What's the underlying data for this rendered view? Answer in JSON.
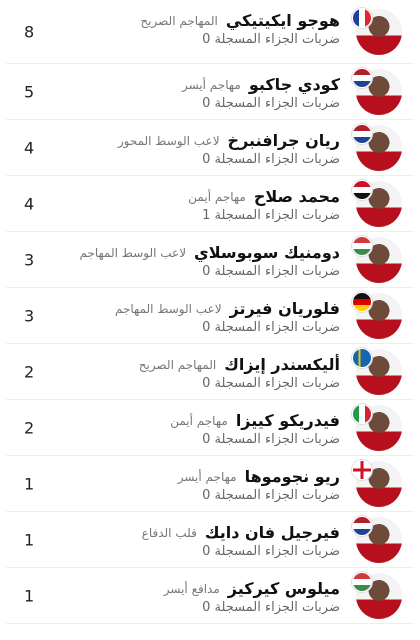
{
  "rows": [
    {
      "name": "هوجو ايكيتيكي",
      "position": "المهاجم الصريح",
      "stat_label": "ضربات الجزاء المسجلة",
      "stat_value": "0",
      "value": "8",
      "flag": "france"
    },
    {
      "name": "كودي جاكبو",
      "position": "مهاجم أيسر",
      "stat_label": "ضربات الجزاء المسجلة",
      "stat_value": "0",
      "value": "5",
      "flag": "netherlands"
    },
    {
      "name": "ريان جرافنبرخ",
      "position": "لاعب الوسط المحور",
      "stat_label": "ضربات الجزاء المسجلة",
      "stat_value": "0",
      "value": "4",
      "flag": "netherlands"
    },
    {
      "name": "محمد صلاح",
      "position": "مهاجم أيمن",
      "stat_label": "ضربات الجزاء المسجلة",
      "stat_value": "1",
      "value": "4",
      "flag": "egypt"
    },
    {
      "name": "دومنيك سوبوسلاي",
      "position": "لاعب الوسط المهاجم",
      "stat_label": "ضربات الجزاء المسجلة",
      "stat_value": "0",
      "value": "3",
      "flag": "hungary"
    },
    {
      "name": "فلوريان فيرتز",
      "position": "لاعب الوسط المهاجم",
      "stat_label": "ضربات الجزاء المسجلة",
      "stat_value": "0",
      "value": "3",
      "flag": "germany"
    },
    {
      "name": "أليكسندر إيزاك",
      "position": "المهاجم الصريح",
      "stat_label": "ضربات الجزاء المسجلة",
      "stat_value": "0",
      "value": "2",
      "flag": "sweden"
    },
    {
      "name": "فيدريكو كييزا",
      "position": "مهاجم أيمن",
      "stat_label": "ضربات الجزاء المسجلة",
      "stat_value": "0",
      "value": "2",
      "flag": "italy"
    },
    {
      "name": "ريو نجوموها",
      "position": "مهاجم أيسر",
      "stat_label": "ضربات الجزاء المسجلة",
      "stat_value": "0",
      "value": "1",
      "flag": "england"
    },
    {
      "name": "فيرجيل فان دايك",
      "position": "قلب الدفاع",
      "stat_label": "ضربات الجزاء المسجلة",
      "stat_value": "0",
      "value": "1",
      "flag": "netherlands"
    },
    {
      "name": "ميلوس كيركيز",
      "position": "مدافع أيسر",
      "stat_label": "ضربات الجزاء المسجلة",
      "stat_value": "0",
      "value": "1",
      "flag": "hungary"
    }
  ],
  "flag_colors": {
    "france": [
      "#1e3f9a",
      "#ffffff",
      "#e0262e"
    ],
    "netherlands": [
      "#b0202a",
      "#ffffff",
      "#1e4594"
    ],
    "egypt": [
      "#ce1126",
      "#ffffff",
      "#111111"
    ],
    "hungary": [
      "#d23a3a",
      "#ffffff",
      "#3b8b4f"
    ],
    "germany": [
      "#111111",
      "#dd0000",
      "#ffce00"
    ],
    "sweden": [
      "#1467b0",
      "#f6c400"
    ],
    "italy": [
      "#219b4a",
      "#ffffff",
      "#d0263b"
    ],
    "england": [
      "#ffffff",
      "#ce1124"
    ]
  }
}
